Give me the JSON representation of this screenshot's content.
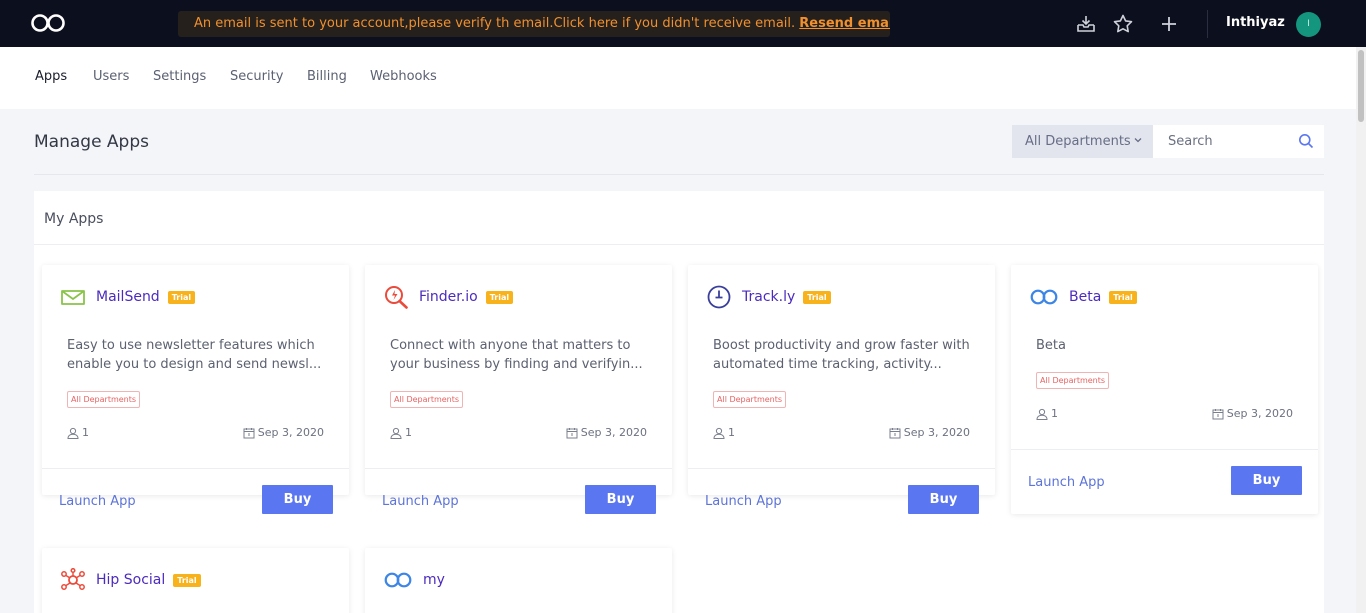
{
  "topbar": {
    "notice_text": "An email is sent to your account,please verify th email.Click here if you didn't receive email.",
    "resend_label": "Resend email",
    "username": "Inthiyaz",
    "avatar_initial": "I"
  },
  "nav": {
    "tabs": [
      {
        "label": "Apps"
      },
      {
        "label": "Users"
      },
      {
        "label": "Settings"
      },
      {
        "label": "Security"
      },
      {
        "label": "Billing"
      },
      {
        "label": "Webhooks"
      }
    ]
  },
  "header": {
    "title": "Manage Apps",
    "dept_select": "All Departments",
    "search_placeholder": "Search"
  },
  "panel": {
    "title": "My Apps"
  },
  "apps": [
    {
      "name": "MailSend",
      "badge": "Trial",
      "desc1": "Easy to use newsletter features which",
      "desc2": "enable you to design and send newsl...",
      "dept": "All Departments",
      "users": "1",
      "date": "Sep 3, 2020",
      "launch": "Launch App",
      "buy": "Buy"
    },
    {
      "name": "Finder.io",
      "badge": "Trial",
      "desc1": "Connect with anyone that matters to",
      "desc2": "your business by finding and verifyin...",
      "dept": "All Departments",
      "users": "1",
      "date": "Sep 3, 2020",
      "launch": "Launch App",
      "buy": "Buy"
    },
    {
      "name": "Track.ly",
      "badge": "Trial",
      "desc1": "Boost productivity and grow faster with",
      "desc2": "automated time tracking, activity...",
      "dept": "All Departments",
      "users": "1",
      "date": "Sep 3, 2020",
      "launch": "Launch App",
      "buy": "Buy"
    },
    {
      "name": "Beta",
      "badge": "Trial",
      "desc1": "Beta",
      "dept": "All Departments",
      "users": "1",
      "date": "Sep 3, 2020",
      "launch": "Launch App",
      "buy": "Buy"
    },
    {
      "name": "Hip Social",
      "badge": "Trial"
    },
    {
      "name": "my"
    }
  ],
  "colors": {
    "topbar_bg": "#0c0f1d",
    "notice_text": "#f0902e",
    "app_name": "#4b2bbf",
    "trial_badge": "#f7b21c",
    "buy_button": "#5b76f1",
    "launch_link": "#5d74d8"
  }
}
